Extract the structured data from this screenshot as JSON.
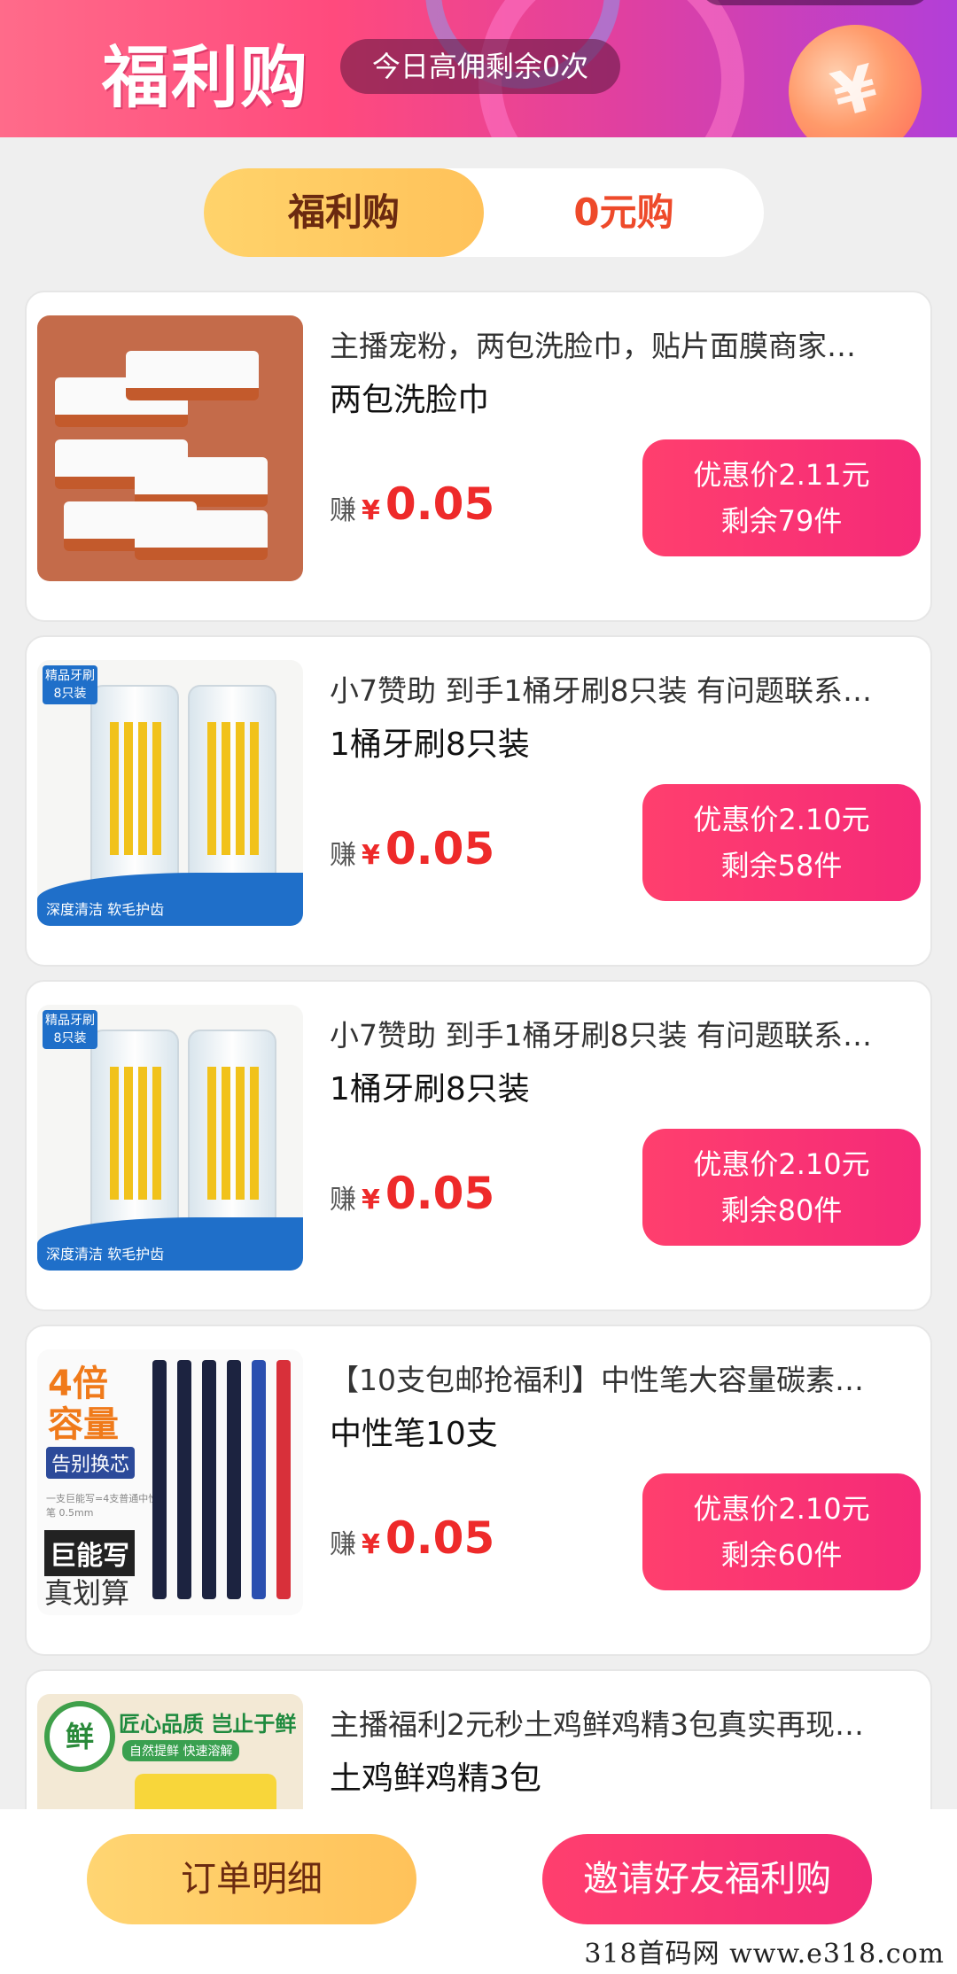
{
  "header": {
    "brand": "福利购",
    "quota": "今日高佣剩余0次"
  },
  "tabs": [
    {
      "label": "福利购",
      "active": true
    },
    {
      "label": "0元购",
      "active": false
    }
  ],
  "products": [
    {
      "title": "主播宠粉，两包洗脸巾，贴片面膜商家…",
      "subtitle": "两包洗脸巾",
      "earn_label": "赚",
      "currency": "¥",
      "earn": "0.05",
      "price": "优惠价2.11元",
      "stock": "剩余79件"
    },
    {
      "title": "小7赞助 到手1桶牙刷8只装 有问题联系…",
      "subtitle": "1桶牙刷8只装",
      "earn_label": "赚",
      "currency": "¥",
      "earn": "0.05",
      "price": "优惠价2.10元",
      "stock": "剩余58件",
      "thumb_badge": "精品牙刷 8只装",
      "thumb_caption": "深度清洁 软毛护齿"
    },
    {
      "title": "小7赞助 到手1桶牙刷8只装 有问题联系…",
      "subtitle": "1桶牙刷8只装",
      "earn_label": "赚",
      "currency": "¥",
      "earn": "0.05",
      "price": "优惠价2.10元",
      "stock": "剩余80件",
      "thumb_badge": "精品牙刷 8只装",
      "thumb_caption": "深度清洁 软毛护齿"
    },
    {
      "title": "【10支包邮抢福利】中性笔大容量碳素…",
      "subtitle": "中性笔10支",
      "earn_label": "赚",
      "currency": "¥",
      "earn": "0.05",
      "price": "优惠价2.10元",
      "stock": "剩余60件",
      "thumb_big": "4倍容量",
      "thumb_tag": "告别换芯",
      "thumb_small": "一支巨能写=4支普通中性笔 0.5mm",
      "thumb_black": "巨能写",
      "thumb_bottom": "真划算"
    },
    {
      "title": "主播福利2元秒土鸡鲜鸡精3包真实再现…",
      "subtitle": "土鸡鲜鸡精3包",
      "thumb_circle": "鲜",
      "thumb_head": "匠心品质 岂止于鲜",
      "thumb_strip": "自然提鲜 快速溶解"
    }
  ],
  "bottom": {
    "orders_label": "订单明细",
    "invite_label": "邀请好友福利购"
  },
  "watermark": "318首码网  www.e318.com",
  "colors": {
    "accent_pink": "#f52a78",
    "accent_yellow": "#ffc25a",
    "price_red": "#ee2a2a"
  }
}
